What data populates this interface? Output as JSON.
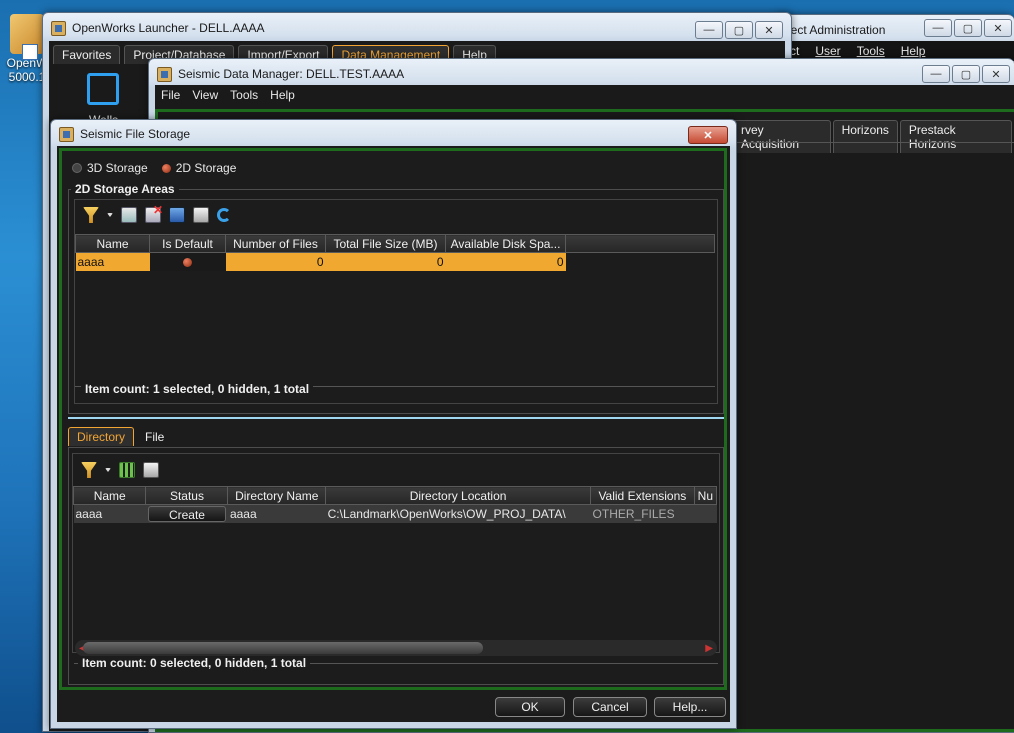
{
  "desktop": {
    "icon_label_1": "OpenW",
    "icon_label_2": "5000.1"
  },
  "launcher": {
    "title": "OpenWorks Launcher - DELL.AAAA",
    "menu": [
      "Favorites",
      "Project/Database",
      "Import/Export",
      "Data Management",
      "Help"
    ],
    "left_label": "Wells"
  },
  "project_admin": {
    "title": "ject Administration",
    "menu": [
      "ct",
      "User",
      "Tools",
      "Help"
    ]
  },
  "sdm": {
    "title": "Seismic Data Manager: DELL.TEST.AAAA",
    "menu": [
      "File",
      "View",
      "Tools",
      "Help"
    ],
    "tabs": [
      "rvey Acquisition",
      "Horizons",
      "Prestack Horizons"
    ]
  },
  "dialog": {
    "title": "Seismic File Storage",
    "radio_3d": "3D Storage",
    "radio_2d": "2D Storage",
    "areas_title": "2D Storage Areas",
    "areas_table": {
      "headers": [
        "Name",
        "Is Default",
        "Number of Files",
        "Total File Size (MB)",
        "Available Disk Spa..."
      ],
      "rows": [
        {
          "name": "aaaa",
          "files": "0",
          "size": "0",
          "disk": "0"
        }
      ]
    },
    "areas_count": "Item count: 1 selected, 0 hidden, 1 total",
    "lower_tabs": [
      "Directory",
      "File"
    ],
    "dir_table": {
      "headers": [
        "Name",
        "Status",
        "Directory Name",
        "Directory Location",
        "Valid Extensions",
        "Nu"
      ],
      "rows": [
        {
          "name": "aaaa",
          "status": "Create",
          "dirname": "aaaa",
          "location": "C:\\Landmark\\OpenWorks\\OW_PROJ_DATA\\",
          "ext": "OTHER_FILES"
        }
      ]
    },
    "dir_count": "Item count: 0 selected, 0 hidden, 1 total",
    "buttons": {
      "ok": "OK",
      "cancel": "Cancel",
      "help": "Help..."
    }
  }
}
